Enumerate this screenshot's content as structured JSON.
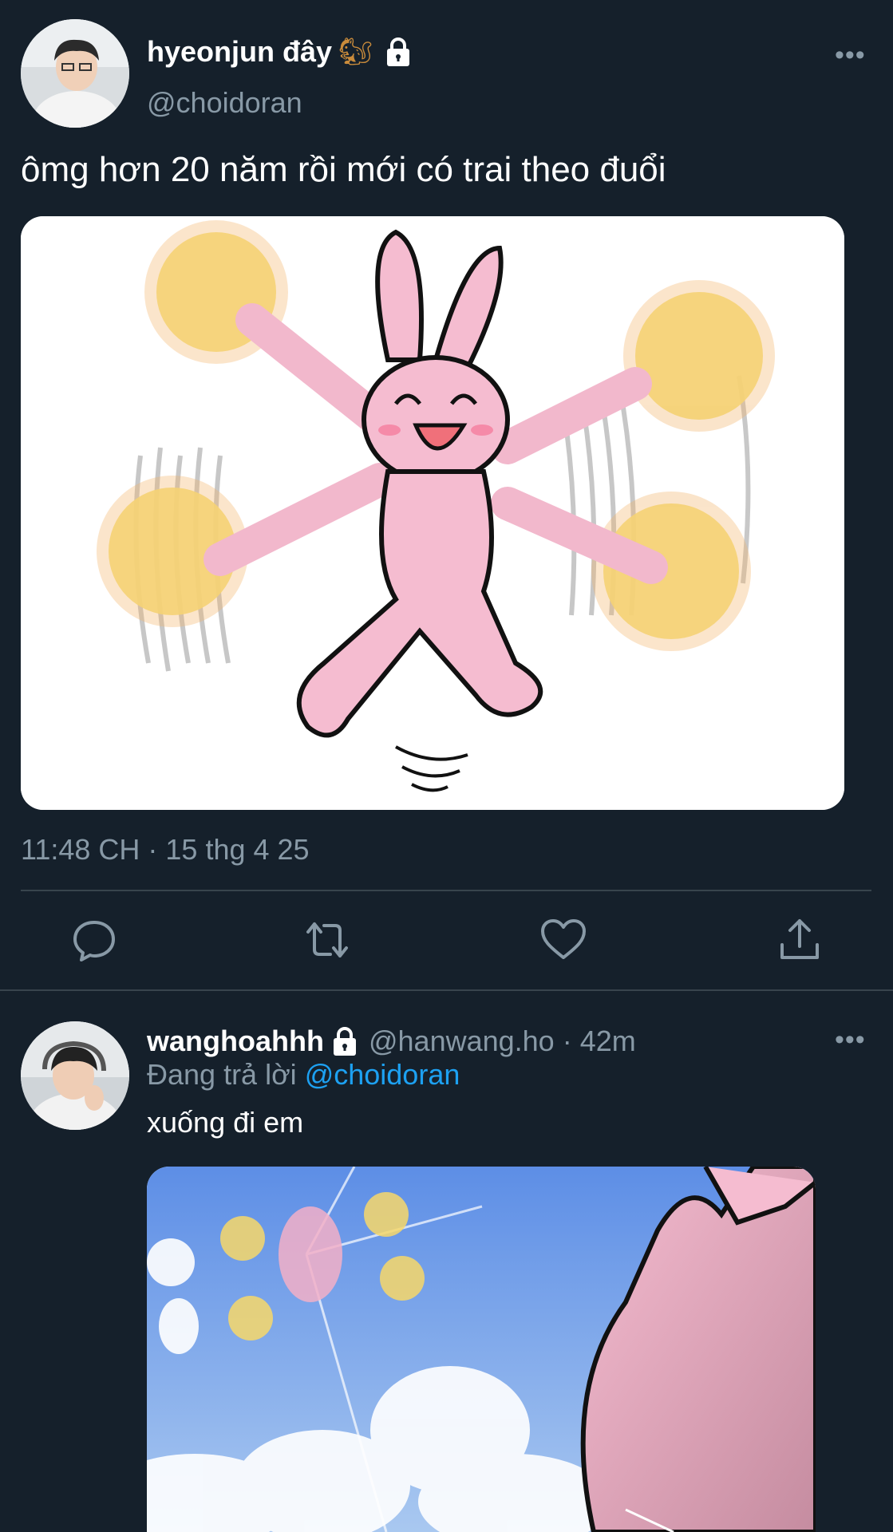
{
  "main_tweet": {
    "display_name": "hyeonjun đây",
    "name_emoji": "🐿",
    "handle": "@choidoran",
    "text": "ômg hơn 20 năm rồi mới có trai theo đuổi",
    "timestamp": "11:48 CH · 15 thg 4 25",
    "more_label": "•••",
    "actions": [
      "reply-icon",
      "retweet-icon",
      "like-icon",
      "share-icon"
    ]
  },
  "reply_tweet": {
    "display_name": "wanghoahhh",
    "handle": "@hanwang.ho",
    "dot": "·",
    "time": "42m",
    "replying_prefix": "Đang trả lời",
    "replying_to": "@choidoran",
    "text": "xuống đi em",
    "more_label": "•••"
  },
  "colors": {
    "background": "#15202b",
    "secondary_text": "#8899a6",
    "accent": "#1da1f2",
    "separator": "#38444d"
  }
}
